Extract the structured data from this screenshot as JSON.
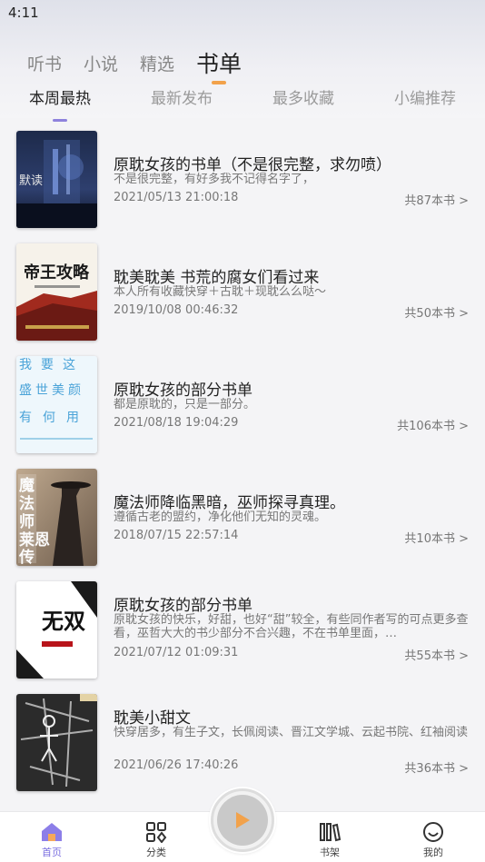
{
  "status": {
    "time": "4:11"
  },
  "main_tabs": [
    {
      "label": "听书",
      "active": false
    },
    {
      "label": "小说",
      "active": false
    },
    {
      "label": "精选",
      "active": false
    },
    {
      "label": "书单",
      "active": true
    }
  ],
  "sub_tabs": [
    {
      "label": "本周最热",
      "active": true
    },
    {
      "label": "最新发布",
      "active": false
    },
    {
      "label": "最多收藏",
      "active": false
    },
    {
      "label": "小编推荐",
      "active": false
    }
  ],
  "booklists": [
    {
      "title": "原耽女孩的书单（不是很完整，求勿喷）",
      "desc": "不是很完整，有好多我不记得名字了，",
      "date": "2021/05/13 21:00:18",
      "count": "共87本书 >",
      "cover": {
        "text": "默读",
        "text_secondary": ""
      }
    },
    {
      "title": "耽美耽美 书荒的腐女们看过来",
      "desc": "本人所有收藏快穿＋古耽＋现耽么么哒～",
      "date": "2019/10/08 00:46:32",
      "count": "共50本书 >",
      "cover": {
        "text": "帝王攻略",
        "text_secondary": ""
      }
    },
    {
      "title": "原耽女孩的部分书单",
      "desc": "都是原耽的，只是一部分。",
      "date": "2021/08/18 19:04:29",
      "count": "共106本书 >",
      "cover": {
        "text": "我要这盛世美颜有何用",
        "text_secondary": ""
      }
    },
    {
      "title": "魔法师降临黑暗，巫师探寻真理。",
      "desc": "遵循古老的盟约，净化他们无知的灵魂。",
      "date": "2018/07/15 22:57:14",
      "count": "共10本书 >",
      "cover": {
        "text": "魔法师莱恩传",
        "text_secondary": ""
      }
    },
    {
      "title": "原耽女孩的部分书单",
      "desc": "原耽女孩的快乐，好甜，也好“甜”较全，有些同作者写的可点更多查看，巫哲大大的书少部分不合兴趣，不在书单里面，…",
      "date": "2021/07/12 01:09:31",
      "count": "共55本书 >",
      "cover": {
        "text": "无双",
        "text_secondary": ""
      }
    },
    {
      "title": "耽美小甜文",
      "desc": "快穿居多，有生子文，长佩阅读、晋江文学城、云起书院、红袖阅读",
      "date": "2021/06/26 17:40:26",
      "count": "共36本书 >",
      "cover": {
        "text": "",
        "text_secondary": ""
      }
    }
  ],
  "bottom_nav": [
    {
      "label": "首页",
      "icon": "home-icon",
      "active": true
    },
    {
      "label": "分类",
      "icon": "category-icon",
      "active": false
    },
    {
      "label": "书架",
      "icon": "bookshelf-icon",
      "active": false
    },
    {
      "label": "我的",
      "icon": "profile-icon",
      "active": false
    }
  ],
  "player": {
    "icon": "play-icon"
  },
  "colors": {
    "accent_orange": "#f2a24b",
    "accent_purple": "#7b6fe0",
    "background": "#f4f4f6"
  }
}
